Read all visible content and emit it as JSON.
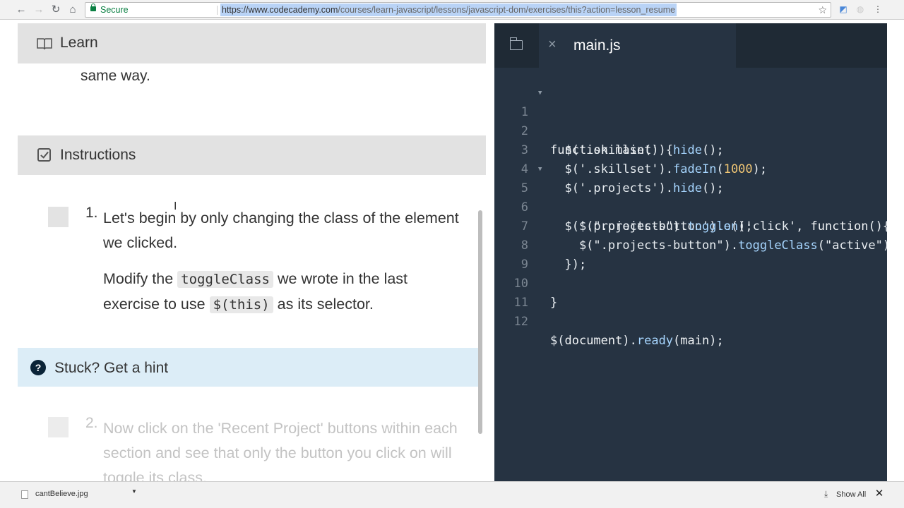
{
  "browser": {
    "secure_label": "Secure",
    "url_scheme_host": "https://www.codecademy.com",
    "url_path": "/courses/learn-javascript/lessons/javascript-dom/exercises/this?action=lesson_resume"
  },
  "lesson": {
    "learn_header": "Learn",
    "learn_tail_text": "same way.",
    "instructions_header": "Instructions",
    "tasks": [
      {
        "number": "1.",
        "paragraph1": "Let's begin by only changing the class of the element we clicked.",
        "p2_before": "Modify the",
        "p2_code1": "toggleClass",
        "p2_middle": "we wrote in the last exercise to use",
        "p2_code2": "$(this)",
        "p2_after": "as its selector."
      },
      {
        "number": "2.",
        "paragraph1": "Now click on the 'Recent Project' buttons within each section and see that only the button you click on will toggle its class."
      }
    ],
    "hint_label": "Stuck? Get a hint",
    "hint_icon": "?"
  },
  "editor": {
    "file_name": "main.js",
    "close_icon": "×",
    "lines": [
      {
        "n": "1",
        "fold": true
      },
      {
        "n": "2"
      },
      {
        "n": "3"
      },
      {
        "n": "4"
      },
      {
        "n": "5",
        "fold": true
      },
      {
        "n": "6"
      },
      {
        "n": "7"
      },
      {
        "n": "8"
      },
      {
        "n": "9"
      },
      {
        "n": "10"
      },
      {
        "n": "11"
      },
      {
        "n": "12"
      }
    ]
  },
  "downloads": {
    "file_name": "cantBelieve.jpg",
    "show_all_label": "Show All"
  },
  "colors": {
    "editor_bg": "#263342",
    "tabs_bg": "#1f2a35",
    "hint_bg": "#dcedf7",
    "section_header_bg": "#e2e2e2"
  }
}
